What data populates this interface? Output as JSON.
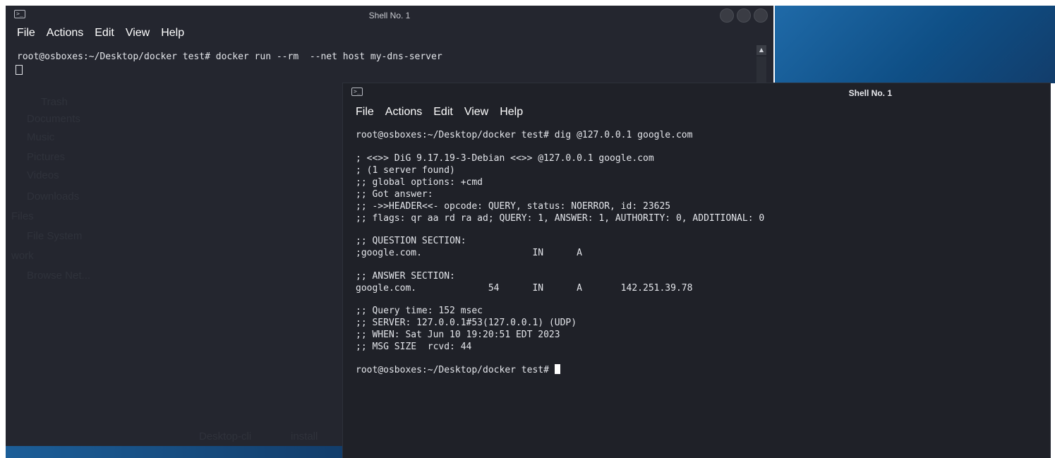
{
  "desktop": {
    "sidebar_ghost": [
      "Trash",
      "Documents",
      "Music",
      "Pictures",
      "Videos",
      "Downloads",
      "Files",
      "File System",
      "work",
      "Browse Net..."
    ],
    "taskbar_ghost": [
      "Desktop-cli",
      "install"
    ]
  },
  "shell_back": {
    "title": "Shell No. 1",
    "menu": [
      "File",
      "Actions",
      "Edit",
      "View",
      "Help"
    ],
    "lines": [
      "root@osboxes:~/Desktop/docker test# docker run --rm  --net host my-dns-server"
    ]
  },
  "shell_front": {
    "title": "Shell No. 1",
    "menu": [
      "File",
      "Actions",
      "Edit",
      "View",
      "Help"
    ],
    "lines": [
      "root@osboxes:~/Desktop/docker test# dig @127.0.0.1 google.com",
      "",
      "; <<>> DiG 9.17.19-3-Debian <<>> @127.0.0.1 google.com",
      "; (1 server found)",
      ";; global options: +cmd",
      ";; Got answer:",
      ";; ->>HEADER<<- opcode: QUERY, status: NOERROR, id: 23625",
      ";; flags: qr aa rd ra ad; QUERY: 1, ANSWER: 1, AUTHORITY: 0, ADDITIONAL: 0",
      "",
      ";; QUESTION SECTION:",
      ";google.com.                    IN      A",
      "",
      ";; ANSWER SECTION:",
      "google.com.             54      IN      A       142.251.39.78",
      "",
      ";; Query time: 152 msec",
      ";; SERVER: 127.0.0.1#53(127.0.0.1) (UDP)",
      ";; WHEN: Sat Jun 10 19:20:51 EDT 2023",
      ";; MSG SIZE  rcvd: 44",
      ""
    ],
    "prompt": "root@osboxes:~/Desktop/docker test# "
  }
}
